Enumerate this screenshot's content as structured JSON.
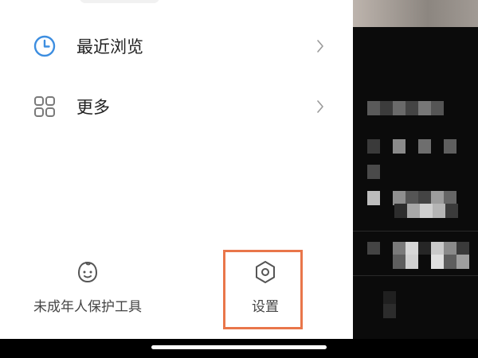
{
  "menu": {
    "items": [
      {
        "label": "最近浏览",
        "icon": "clock-icon"
      },
      {
        "label": "更多",
        "icon": "grid-icon"
      }
    ]
  },
  "bottom_bar": {
    "minor_protection": {
      "label": "未成年人保护工具",
      "icon": "baby-face-icon"
    },
    "settings": {
      "label": "设置",
      "icon": "settings-hexagon-icon"
    }
  },
  "colors": {
    "accent_blue": "#3d8ee0",
    "highlight_border": "#e9764a",
    "text_primary": "#222222",
    "text_secondary": "#444444",
    "icon_gray": "#7a7a7a"
  }
}
